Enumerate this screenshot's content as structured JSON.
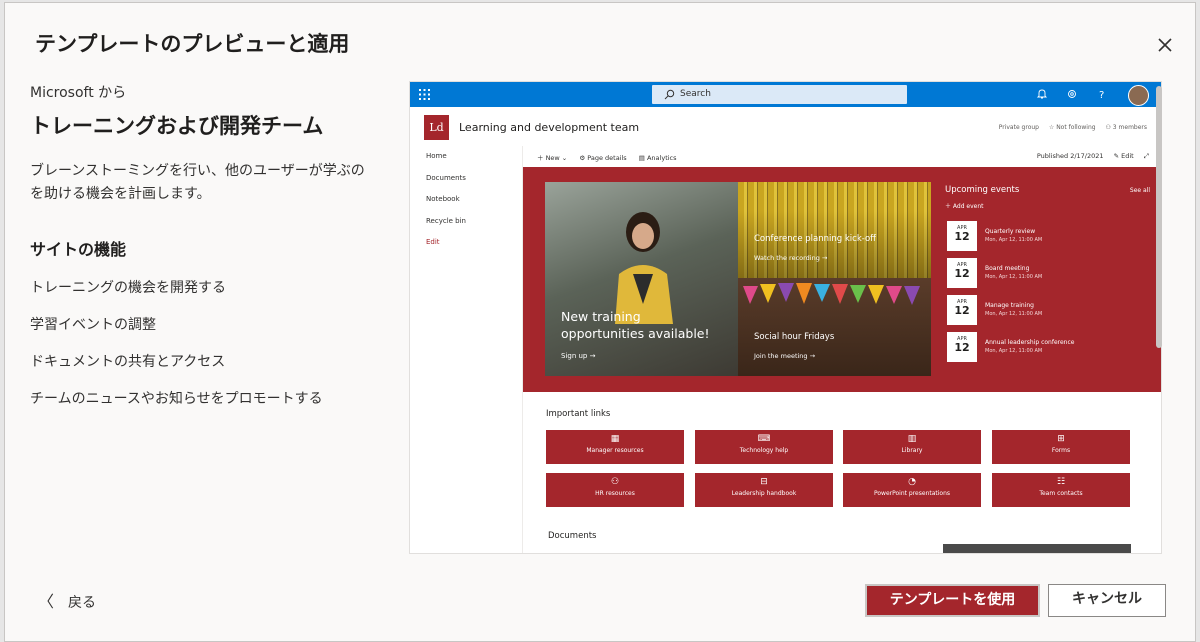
{
  "dialog": {
    "title": "テンプレートのプレビューと適用",
    "close_icon": "close-icon"
  },
  "template": {
    "from": "Microsoft から",
    "name": "トレーニングおよび開発チーム",
    "description": "ブレーンストーミングを行い、他のユーザーが学ぶのを助ける機会を計画します。",
    "features_heading": "サイトの機能",
    "features": [
      "トレーニングの機会を開発する",
      "学習イベントの調整",
      "ドキュメントの共有とアクセス",
      "チームのニュースやお知らせをプロモートする"
    ]
  },
  "preview": {
    "search_placeholder": "Search",
    "logo_text": "Ld",
    "site_name": "Learning and development team",
    "site_meta": [
      "Private group",
      "☆ Not following",
      "⚇ 3 members"
    ],
    "nav": [
      "Home",
      "Documents",
      "Notebook",
      "Recycle bin",
      "Edit"
    ],
    "commands": [
      "＋ New ⌄",
      "⚙ Page details",
      "▤ Analytics"
    ],
    "published": "Published 2/17/2021",
    "edit": "✎ Edit",
    "hero": {
      "main_title": "New training opportunities available!",
      "main_link": "Sign up →",
      "tile2_title": "Conference planning kick-off",
      "tile2_link": "Watch the recording →",
      "tile3_title": "Social hour Fridays",
      "tile3_link": "Join the meeting →"
    },
    "events": {
      "heading": "Upcoming events",
      "see_all": "See all",
      "add": "＋ Add event",
      "items": [
        {
          "month": "APR",
          "day": "12",
          "name": "Quarterly review",
          "time": "Mon, Apr 12, 11:00 AM"
        },
        {
          "month": "APR",
          "day": "12",
          "name": "Board meeting",
          "time": "Mon, Apr 12, 11:00 AM"
        },
        {
          "month": "APR",
          "day": "12",
          "name": "Manage training",
          "time": "Mon, Apr 12, 11:00 AM"
        },
        {
          "month": "APR",
          "day": "12",
          "name": "Annual leadership conference",
          "time": "Mon, Apr 12, 11:00 AM"
        }
      ]
    },
    "links_heading": "Important links",
    "links": [
      {
        "icon": "▦",
        "label": "Manager resources"
      },
      {
        "icon": "⌨",
        "label": "Technology help"
      },
      {
        "icon": "▥",
        "label": "Library"
      },
      {
        "icon": "⊞",
        "label": "Forms"
      },
      {
        "icon": "⚇",
        "label": "HR resources"
      },
      {
        "icon": "⊟",
        "label": "Leadership handbook"
      },
      {
        "icon": "◔",
        "label": "PowerPoint presentations"
      },
      {
        "icon": "☷",
        "label": "Team contacts"
      }
    ],
    "documents_heading": "Documents"
  },
  "footer": {
    "back": "戻る",
    "use_template": "テンプレートを使用",
    "cancel": "キャンセル"
  },
  "colors": {
    "accent": "#a4262c",
    "suite_bar": "#0078d4"
  }
}
